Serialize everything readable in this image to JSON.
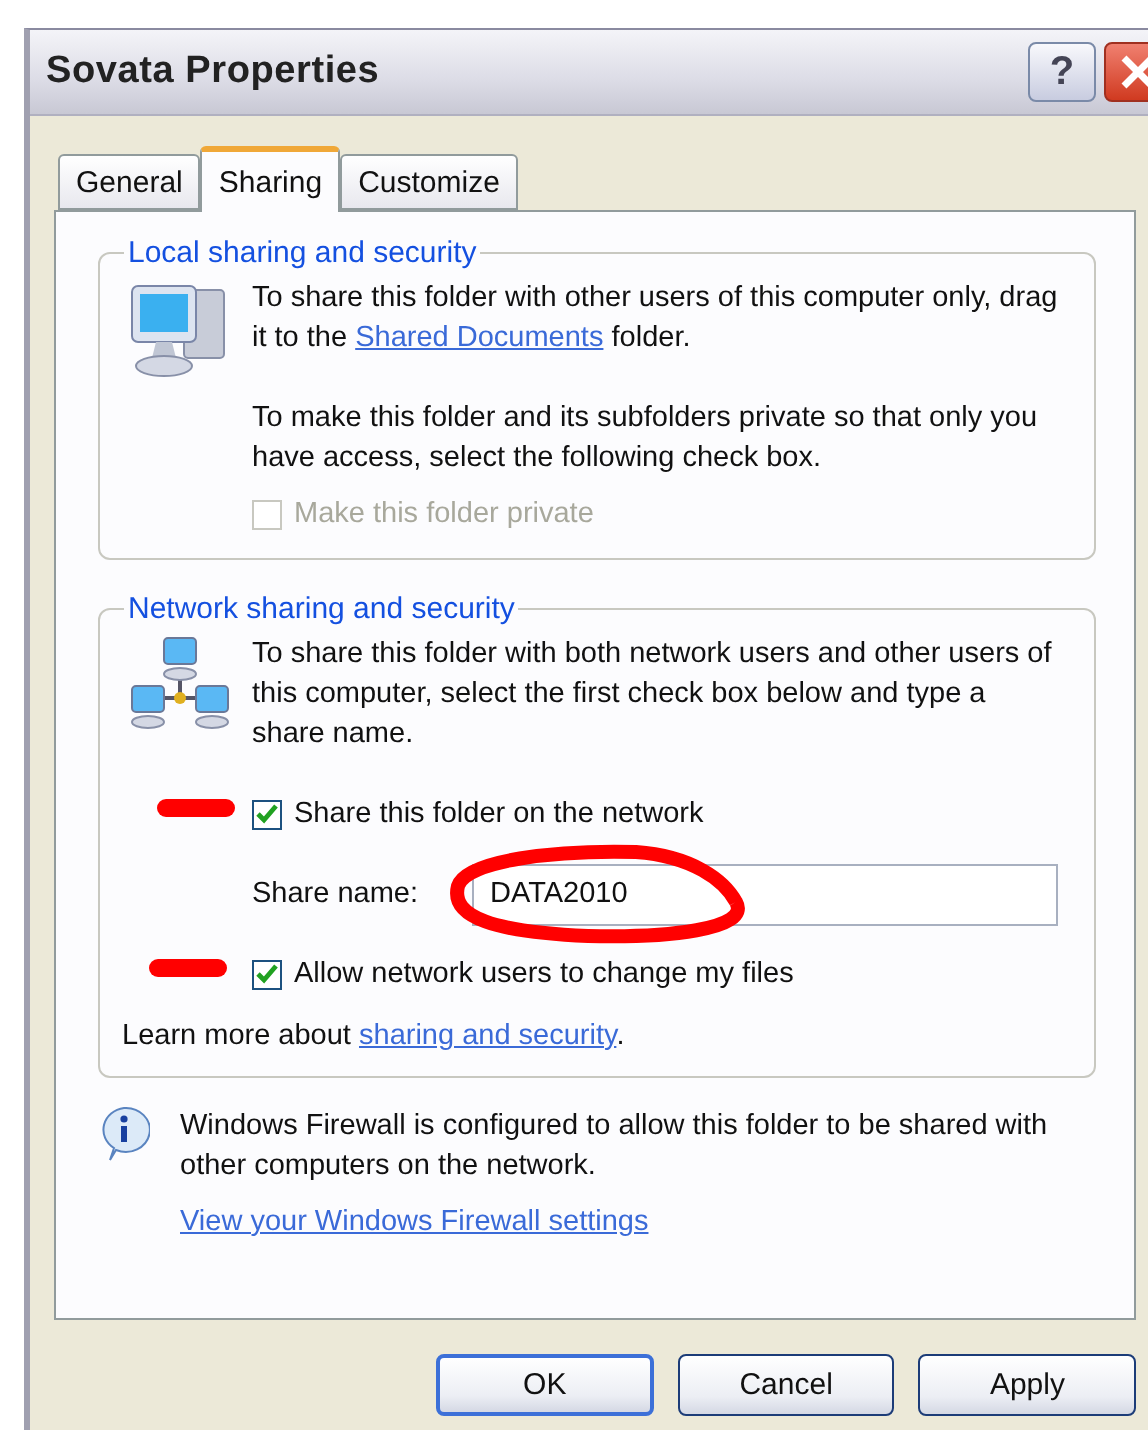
{
  "window": {
    "title": "Sovata Properties",
    "help_button": "?"
  },
  "tabs": [
    {
      "label": "General",
      "selected": false
    },
    {
      "label": "Sharing",
      "selected": true
    },
    {
      "label": "Customize",
      "selected": false
    }
  ],
  "local_section": {
    "legend": "Local sharing and security",
    "text_before": "To share this folder with other users of this computer only, drag it to the",
    "link": "Shared Documents",
    "text_after": "folder.",
    "paragraph": "To make this folder and its subfolders private so that only you have access, select the following check box.",
    "checkbox": {
      "label": "Make this folder private",
      "checked": false,
      "disabled": true
    }
  },
  "network_section": {
    "legend": "Network sharing and security",
    "paragraph": "To share this folder with both network users and other users of this computer, select the first check box below and type a share name.",
    "checkboxes": [
      {
        "label": "Share this folder on the network",
        "checked": true,
        "disabled": false
      },
      {
        "label": "Allow network users to change my files",
        "checked": true,
        "disabled": false
      }
    ],
    "share_name": {
      "label": "Share name:",
      "value": "DATA2010"
    },
    "learn_more": {
      "text": "Learn more about",
      "link": "sharing and security",
      "suffix": "."
    }
  },
  "firewall": {
    "message": "Windows Firewall is configured to allow this folder to be shared with other computers on the network.",
    "link": "View your Windows Firewall settings"
  },
  "buttons": [
    {
      "label": "OK",
      "default": true
    },
    {
      "label": "Cancel",
      "default": false
    },
    {
      "label": "Apply",
      "default": false
    }
  ],
  "annotations": [
    {
      "kind": "dash"
    },
    {
      "kind": "ellipse"
    },
    {
      "kind": "dash"
    }
  ]
}
